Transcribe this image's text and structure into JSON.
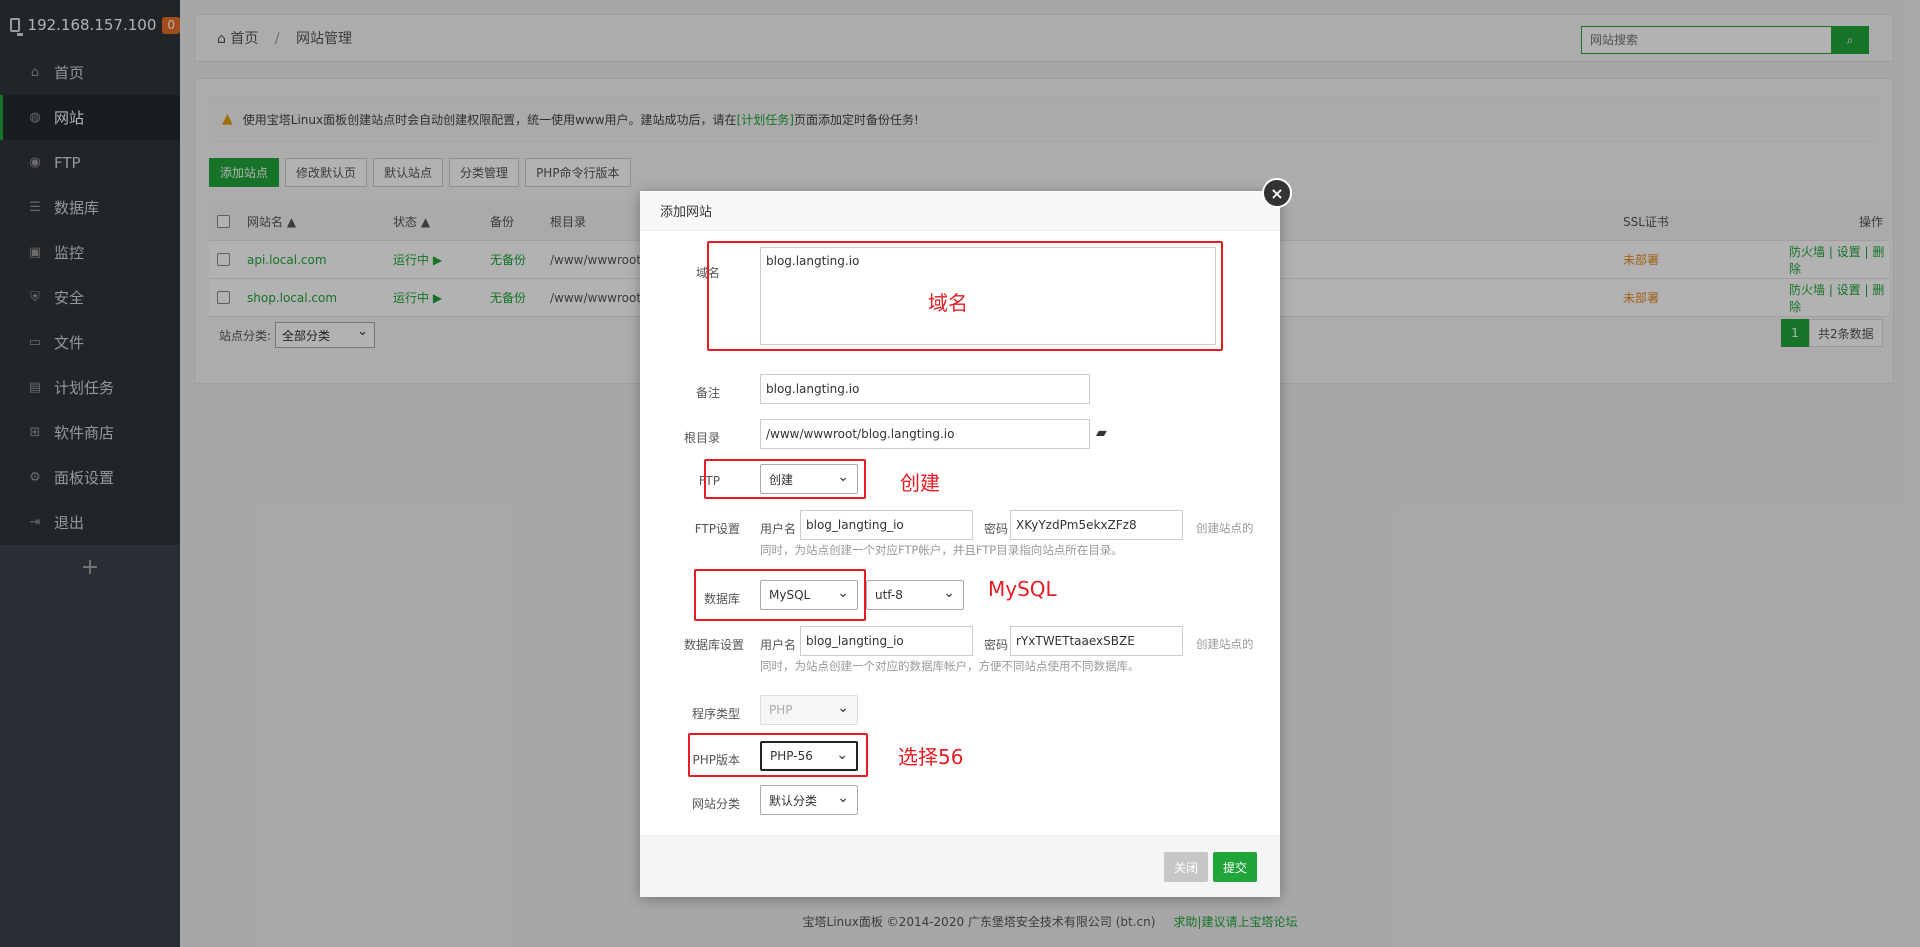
{
  "sidebar": {
    "host": "192.168.157.100",
    "badge": "0",
    "items": [
      {
        "label": "首页",
        "icon": "home-icon"
      },
      {
        "label": "网站",
        "icon": "globe-icon"
      },
      {
        "label": "FTP",
        "icon": "ftp-icon"
      },
      {
        "label": "数据库",
        "icon": "database-icon"
      },
      {
        "label": "监控",
        "icon": "monitor-icon"
      },
      {
        "label": "安全",
        "icon": "shield-icon"
      },
      {
        "label": "文件",
        "icon": "folder-icon"
      },
      {
        "label": "计划任务",
        "icon": "calendar-icon"
      },
      {
        "label": "软件商店",
        "icon": "grid-icon"
      },
      {
        "label": "面板设置",
        "icon": "gear-icon"
      },
      {
        "label": "退出",
        "icon": "logout-icon"
      }
    ],
    "add": "+"
  },
  "breadcrumb": {
    "home": "首页",
    "sep": "/",
    "current": "网站管理"
  },
  "search": {
    "placeholder": "网站搜索"
  },
  "alert": {
    "pre": "使用宝塔Linux面板创建站点时会自动创建权限配置，统一使用www用户。建站成功后，请在",
    "link": "[计划任务]",
    "post": "页面添加定时备份任务!"
  },
  "toolbar": {
    "add": "添加站点",
    "default_page": "修改默认页",
    "default_site": "默认站点",
    "category": "分类管理",
    "php_cli": "PHP命令行版本"
  },
  "table": {
    "headers": {
      "name": "网站名 ▲",
      "status": "状态 ▲",
      "backup": "备份",
      "root": "根目录",
      "ssl": "SSL证书",
      "ops": "操作"
    },
    "rows": [
      {
        "name": "api.local.com",
        "status": "运行中 ▶",
        "backup": "无备份",
        "root": "/www/wwwroot",
        "ssl": "未部署",
        "ops": "防火墙 | 设置 | 删除"
      },
      {
        "name": "shop.local.com",
        "status": "运行中 ▶",
        "backup": "无备份",
        "root": "/www/wwwroot",
        "ssl": "未部署",
        "ops": "防火墙 | 设置 | 删除"
      }
    ],
    "filter_label": "站点分类:",
    "filter_value": "全部分类",
    "page": "1",
    "total": "共2条数据"
  },
  "footer": {
    "copyright": "宝塔Linux面板 ©2014-2020 广东堡塔安全技术有限公司 (bt.cn)",
    "link": "求助|建议请上宝塔论坛"
  },
  "modal": {
    "title": "添加网站",
    "close": "×",
    "domain_label": "域名",
    "domain_value": "blog.langting.io",
    "remark_label": "备注",
    "remark_value": "blog.langting.io",
    "root_label": "根目录",
    "root_value": "/www/wwwroot/blog.langting.io",
    "ftp_label": "FTP",
    "ftp_value": "创建",
    "ftp_settings_label": "FTP设置",
    "user_label": "用户名",
    "ftp_user": "blog_langting_io",
    "pass_label": "密码",
    "ftp_pass": "XKyYzdPm5ekxZFz8",
    "ftp_hint_right": "创建站点的",
    "ftp_hint": "同时，为站点创建一个对应FTP帐户，并且FTP目录指向站点所在目录。",
    "db_label": "数据库",
    "db_value": "MySQL",
    "charset_value": "utf-8",
    "db_settings_label": "数据库设置",
    "db_user": "blog_langting_io",
    "db_pass": "rYxTWETtaaexSBZE",
    "db_hint_right": "创建站点的",
    "db_hint": "同时，为站点创建一个对应的数据库帐户，方便不同站点使用不同数据库。",
    "prog_label": "程序类型",
    "prog_value": "PHP",
    "php_label": "PHP版本",
    "php_value": "PHP-56",
    "cat_label": "网站分类",
    "cat_value": "默认分类",
    "btn_close": "关闭",
    "btn_submit": "提交"
  },
  "annotations": {
    "domain": "域名",
    "ftp": "创建",
    "db": "MySQL",
    "php": "选择56"
  }
}
